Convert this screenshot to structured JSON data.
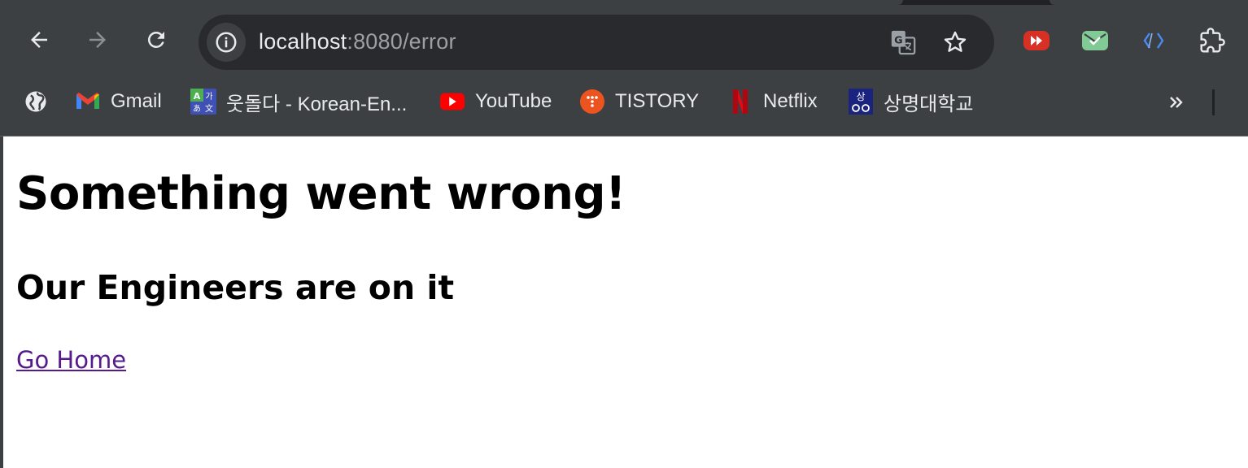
{
  "browser": {
    "url_host": "localhost",
    "url_rest": ":8080/error",
    "icons": {
      "back": "arrow-left-icon",
      "forward": "arrow-right-icon",
      "reload": "reload-icon",
      "site_info": "info-icon",
      "translate": "translate-icon",
      "bookmark_star": "star-icon",
      "extensions": "puzzle-icon"
    },
    "colors": {
      "chrome_bg": "#3c4043",
      "omnibox_bg": "#282a2d",
      "text": "#e8eaed",
      "muted_text": "#9aa0a6"
    }
  },
  "bookmarks": [
    {
      "label": "",
      "icon": "globe-icon"
    },
    {
      "label": "Gmail",
      "icon": "gmail-icon"
    },
    {
      "label": "웃돌다 - Korean-En...",
      "icon": "dictionary-icon"
    },
    {
      "label": "YouTube",
      "icon": "youtube-icon"
    },
    {
      "label": "TISTORY",
      "icon": "tistory-icon"
    },
    {
      "label": "Netflix",
      "icon": "netflix-icon"
    },
    {
      "label": "상명대학교",
      "icon": "university-icon"
    }
  ],
  "page": {
    "heading": "Something went wrong!",
    "subheading": "Our Engineers are on it",
    "link_label": "Go Home",
    "link_color": "#551a8b"
  }
}
